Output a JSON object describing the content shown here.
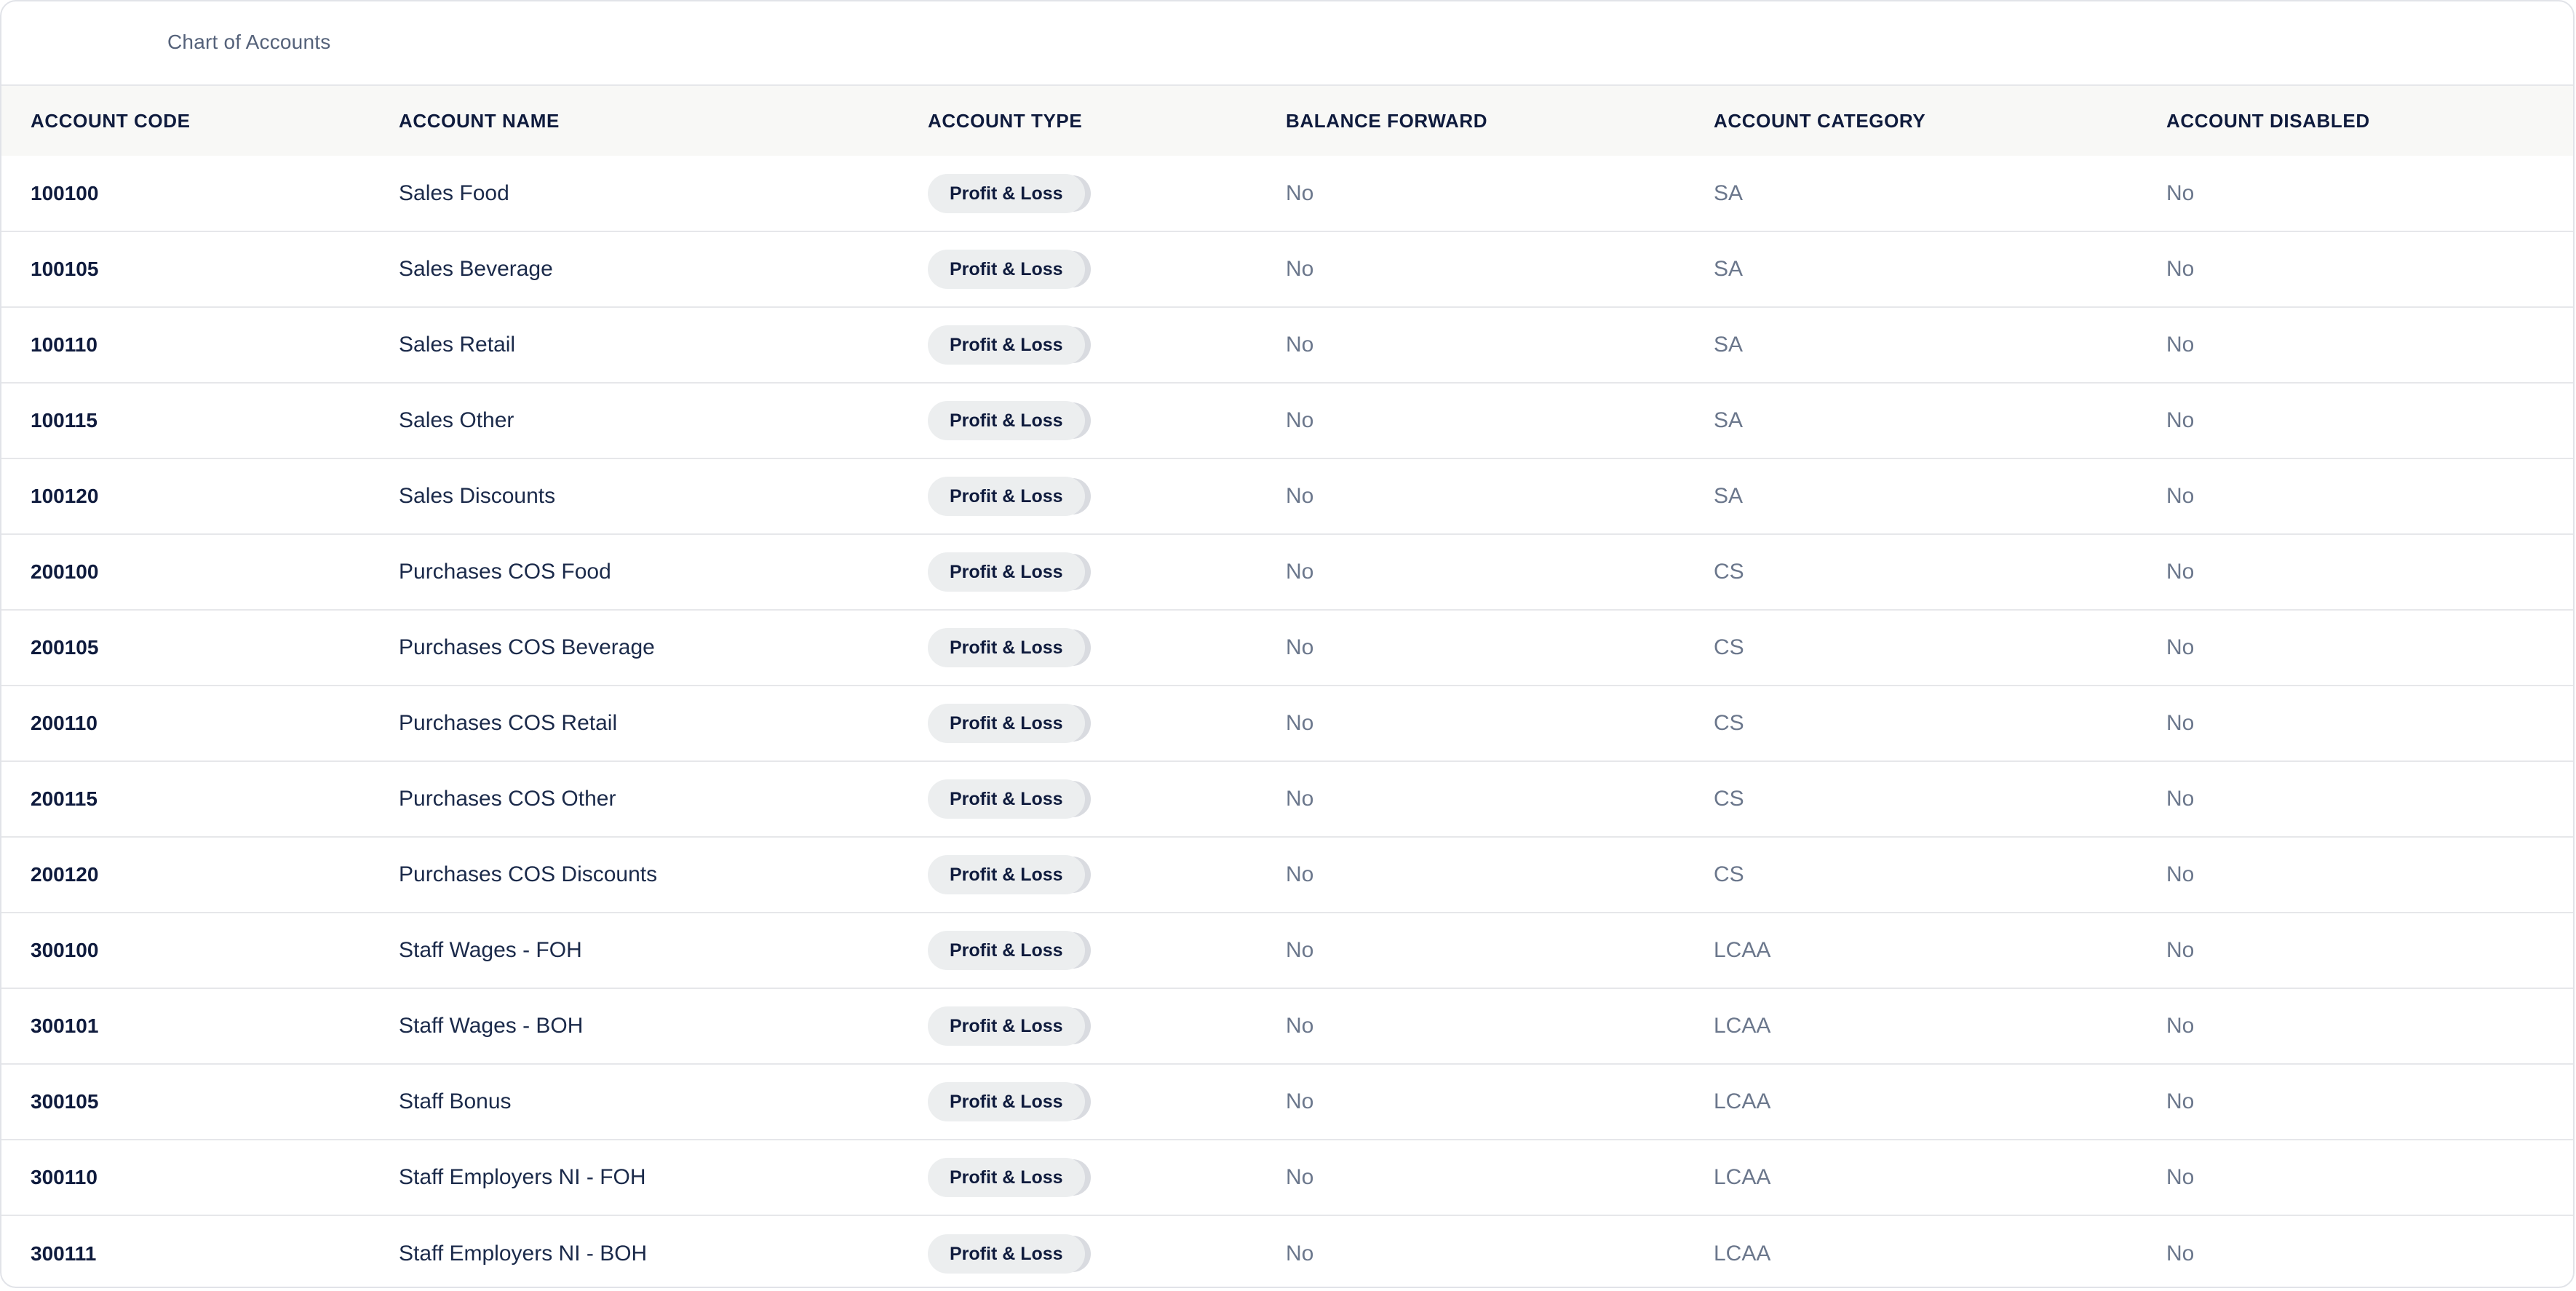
{
  "header": {
    "title": "Chart of Accounts"
  },
  "table": {
    "columns": [
      "ACCOUNT CODE",
      "ACCOUNT NAME",
      "ACCOUNT TYPE",
      "BALANCE FORWARD",
      "ACCOUNT CATEGORY",
      "ACCOUNT DISABLED"
    ],
    "rows": [
      {
        "code": "100100",
        "name": "Sales Food",
        "type": "Profit & Loss",
        "balance_forward": "No",
        "category": "SA",
        "disabled": "No"
      },
      {
        "code": "100105",
        "name": "Sales Beverage",
        "type": "Profit & Loss",
        "balance_forward": "No",
        "category": "SA",
        "disabled": "No"
      },
      {
        "code": "100110",
        "name": "Sales Retail",
        "type": "Profit & Loss",
        "balance_forward": "No",
        "category": "SA",
        "disabled": "No"
      },
      {
        "code": "100115",
        "name": "Sales Other",
        "type": "Profit & Loss",
        "balance_forward": "No",
        "category": "SA",
        "disabled": "No"
      },
      {
        "code": "100120",
        "name": "Sales Discounts",
        "type": "Profit & Loss",
        "balance_forward": "No",
        "category": "SA",
        "disabled": "No"
      },
      {
        "code": "200100",
        "name": "Purchases COS Food",
        "type": "Profit & Loss",
        "balance_forward": "No",
        "category": "CS",
        "disabled": "No"
      },
      {
        "code": "200105",
        "name": "Purchases COS Beverage",
        "type": "Profit & Loss",
        "balance_forward": "No",
        "category": "CS",
        "disabled": "No"
      },
      {
        "code": "200110",
        "name": "Purchases COS Retail",
        "type": "Profit & Loss",
        "balance_forward": "No",
        "category": "CS",
        "disabled": "No"
      },
      {
        "code": "200115",
        "name": "Purchases COS Other",
        "type": "Profit & Loss",
        "balance_forward": "No",
        "category": "CS",
        "disabled": "No"
      },
      {
        "code": "200120",
        "name": "Purchases COS Discounts",
        "type": "Profit & Loss",
        "balance_forward": "No",
        "category": "CS",
        "disabled": "No"
      },
      {
        "code": "300100",
        "name": "Staff Wages - FOH",
        "type": "Profit & Loss",
        "balance_forward": "No",
        "category": "LCAA",
        "disabled": "No"
      },
      {
        "code": "300101",
        "name": "Staff Wages - BOH",
        "type": "Profit & Loss",
        "balance_forward": "No",
        "category": "LCAA",
        "disabled": "No"
      },
      {
        "code": "300105",
        "name": "Staff Bonus",
        "type": "Profit & Loss",
        "balance_forward": "No",
        "category": "LCAA",
        "disabled": "No"
      },
      {
        "code": "300110",
        "name": "Staff Employers NI - FOH",
        "type": "Profit & Loss",
        "balance_forward": "No",
        "category": "LCAA",
        "disabled": "No"
      },
      {
        "code": "300111",
        "name": "Staff Employers NI - BOH",
        "type": "Profit & Loss",
        "balance_forward": "No",
        "category": "LCAA",
        "disabled": "No"
      }
    ]
  },
  "colors": {
    "text_primary": "#0f1b3d",
    "text_muted": "#6b778c",
    "header_bg": "#f8f8f6",
    "pill_bg": "#eceeef",
    "border": "#e6e7ea"
  }
}
